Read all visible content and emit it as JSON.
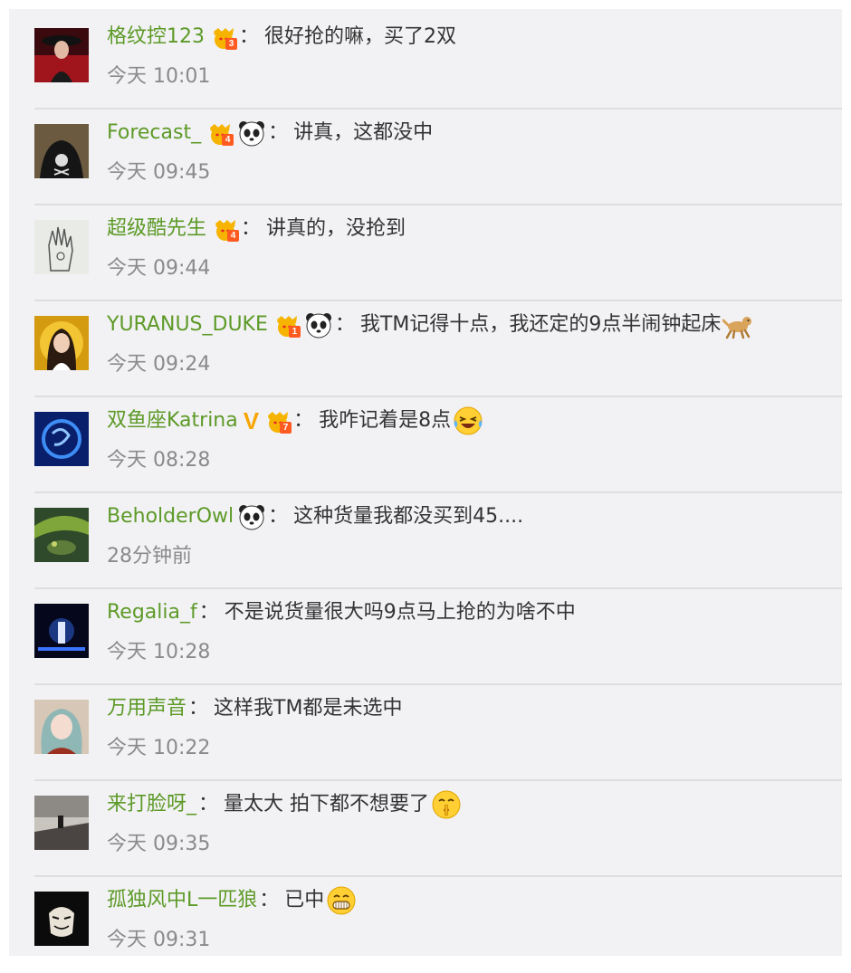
{
  "comments": [
    {
      "username": "格纹控123",
      "badge_level": "3",
      "has_panda": false,
      "has_vip": false,
      "text": "很好抢的嘛，买了2双",
      "emoji": "",
      "time": "今天 10:01",
      "avatar": "avatar-woman-red-hat"
    },
    {
      "username": "Forecast_",
      "badge_level": "4",
      "has_panda": true,
      "has_vip": false,
      "text": "讲真，这都没中",
      "emoji": "",
      "time": "今天 09:45",
      "avatar": "avatar-skull-jacket"
    },
    {
      "username": "超级酷先生",
      "badge_level": "4",
      "has_panda": false,
      "has_vip": false,
      "text": "讲真的，没抢到",
      "emoji": "",
      "time": "今天 09:44",
      "avatar": "avatar-hand-sketch"
    },
    {
      "username": "YURANUS_DUKE",
      "badge_level": "1",
      "has_panda": true,
      "has_vip": false,
      "text": "我TM记得十点，我还定的9点半闹钟起床",
      "emoji": "dog-running-emoji",
      "time": "今天 09:24",
      "avatar": "avatar-girl-yellow"
    },
    {
      "username": "双鱼座Katrina",
      "badge_level": "7",
      "has_panda": false,
      "has_vip": true,
      "text": "我咋记着是8点",
      "emoji": "laughing-tears-emoji",
      "time": "今天 08:28",
      "avatar": "avatar-blue-pisces"
    },
    {
      "username": "BeholderOwl",
      "badge_level": "",
      "has_panda": true,
      "has_vip": false,
      "text": "这种货量我都没买到45....",
      "emoji": "",
      "time": "28分钟前",
      "avatar": "avatar-frog-leaf"
    },
    {
      "username": "Regalia_f",
      "badge_level": "",
      "has_panda": false,
      "has_vip": false,
      "text": "不是说货量很大吗9点马上抢的为啥不中",
      "emoji": "",
      "time": "今天 10:28",
      "avatar": "avatar-stage-concert"
    },
    {
      "username": "万用声音",
      "badge_level": "",
      "has_panda": false,
      "has_vip": false,
      "text": "这样我TM都是未选中",
      "emoji": "",
      "time": "今天 10:22",
      "avatar": "avatar-anime-girl"
    },
    {
      "username": "来打脸呀_",
      "badge_level": "",
      "has_panda": false,
      "has_vip": false,
      "text": "量太大 拍下都不想要了",
      "emoji": "shush-emoji",
      "time": "今天 09:35",
      "avatar": "avatar-road-sunset"
    },
    {
      "username": "孤独风中L一匹狼",
      "badge_level": "",
      "has_panda": false,
      "has_vip": false,
      "text": "已中",
      "emoji": "grin-emoji",
      "time": "今天 09:31",
      "avatar": "avatar-mask-dark"
    }
  ],
  "colors": {
    "username": "#5d9a27",
    "text": "#333333",
    "time": "#8a8a8a",
    "panel_bg": "#f2f2f5",
    "divider": "#dedee2",
    "vip_badge": "#f7a500"
  },
  "colon_glyph": "："
}
